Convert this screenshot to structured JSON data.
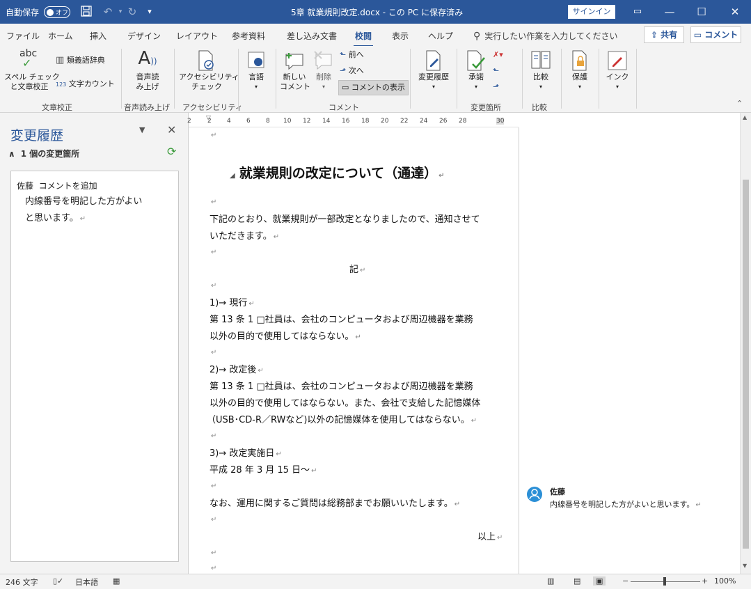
{
  "titlebar": {
    "autosave_label": "自動保存",
    "toggle_label": "オフ",
    "document_title": "5章  就業規則改定.docx - この PC に保存済み",
    "signin": "サインイン",
    "bg_color": "#2b579a"
  },
  "tabs": [
    {
      "label": "ファイル"
    },
    {
      "label": "ホーム"
    },
    {
      "label": "挿入"
    },
    {
      "label": "デザイン"
    },
    {
      "label": "レイアウト"
    },
    {
      "label": "参考資料"
    },
    {
      "label": "差し込み文書"
    },
    {
      "label": "校閲"
    },
    {
      "label": "表示"
    },
    {
      "label": "ヘルプ"
    }
  ],
  "tell_me": "実行したい作業を入力してください",
  "share_label": "共有",
  "comment_label": "コメント",
  "ribbon": {
    "spell_line1": "スペル チェック",
    "spell_line2": "と文章校正",
    "thesaurus": "類義語辞典",
    "word_count": "文字カウント",
    "read_aloud_line1": "音声読",
    "read_aloud_line2": "み上げ",
    "accessibility_line1": "アクセシビリティ",
    "accessibility_line2": "チェック",
    "language": "言語",
    "new_comment_line1": "新しい",
    "new_comment_line2": "コメント",
    "delete": "削除",
    "previous": "前へ",
    "next": "次へ",
    "show_comments": "コメントの表示",
    "track_changes": "変更履歴",
    "accept": "承諾",
    "compare": "比較",
    "protect": "保護",
    "ink": "インク",
    "groups": {
      "proofing": "文章校正",
      "speech": "音声読み上げ",
      "accessibility": "アクセシビリティ",
      "comments": "コメント",
      "changes": "変更箇所",
      "compare": "比較"
    },
    "abc_text": "abc",
    "count_badge": "123"
  },
  "revisions_pane": {
    "title": "変更履歴",
    "summary": "1 個の変更箇所",
    "author": "佐藤",
    "action": "コメントを追加",
    "comment_line1": "内線番号を明記した方がよい",
    "comment_line2": "と思います。"
  },
  "ruler_numbers": [
    "2",
    "2",
    "4",
    "6",
    "8",
    "10",
    "12",
    "14",
    "16",
    "18",
    "20",
    "22",
    "24",
    "26",
    "28",
    "30"
  ],
  "document": {
    "title": "就業規則の改定について（通達）",
    "para1_line1": "下記のとおり、就業規則が一部改定となりましたので、通知させて",
    "para1_line2": "いただきます。",
    "ki": "記",
    "item1_head": "1)→ 現行",
    "item1_line1": "第 13 条  1 □社員は、会社のコンピュータおよび周辺機器を業務",
    "item1_line2": "以外の目的で使用してはならない。",
    "item2_head": "2)→ 改定後",
    "item2_line1": "第 13 条  1 □社員は、会社のコンピュータおよび周辺機器を業務",
    "item2_line2": "以外の目的で使用してはならない。また、会社で支給した記憶媒体",
    "item2_line3": "（USB･CD-R／RWなど)以外の記憶媒体を使用してはならない。",
    "item3_head": "3)→ 改定実施日",
    "item3_line1": "平成 28 年 3 月 15 日〜",
    "closing": "なお、運用に関するご質問は総務部までお願いいたします。",
    "end": "以上",
    "para_mark": "↵"
  },
  "comment_balloon": {
    "author": "佐藤",
    "text": "内線番号を明記した方がよいと思います。"
  },
  "statusbar": {
    "word_count": "246 文字",
    "language": "日本語",
    "zoom": "100%"
  }
}
